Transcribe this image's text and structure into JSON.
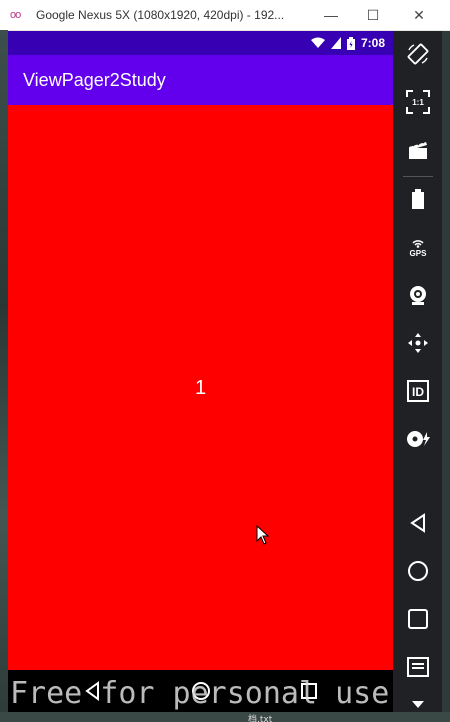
{
  "window": {
    "title": "Google Nexus 5X (1080x1920, 420dpi) - 192...",
    "icon_text": "oo",
    "minimize_label": "—",
    "maximize_label": "☐",
    "close_label": "✕"
  },
  "status_bar": {
    "time": "7:08"
  },
  "app_bar": {
    "title": "ViewPager2Study"
  },
  "page": {
    "number": "1",
    "background_color": "#ff0000"
  },
  "colors": {
    "status_bar": "#3700b3",
    "app_bar": "#6200ee",
    "page": "#ff0000",
    "emulator_toolbar": "#1f2124"
  },
  "watermark": {
    "text": "Free for personal use"
  },
  "taskbar_fragment": {
    "text": "档.txt"
  },
  "emulator_toolbar": {
    "tools": [
      {
        "icon": "rotate-icon"
      },
      {
        "icon": "fit-screen-icon",
        "label": "1:1"
      },
      {
        "icon": "clapper-icon"
      },
      {
        "icon": "battery-icon"
      },
      {
        "icon": "gps-icon",
        "label": "GPS"
      },
      {
        "icon": "camera-icon"
      },
      {
        "icon": "dpad-icon"
      },
      {
        "icon": "id-icon",
        "label": "ID"
      },
      {
        "icon": "disk-icon"
      },
      {
        "icon": "back-icon"
      },
      {
        "icon": "home-icon"
      },
      {
        "icon": "overview-icon"
      },
      {
        "icon": "menu-icon"
      },
      {
        "icon": "more-icon"
      }
    ]
  }
}
